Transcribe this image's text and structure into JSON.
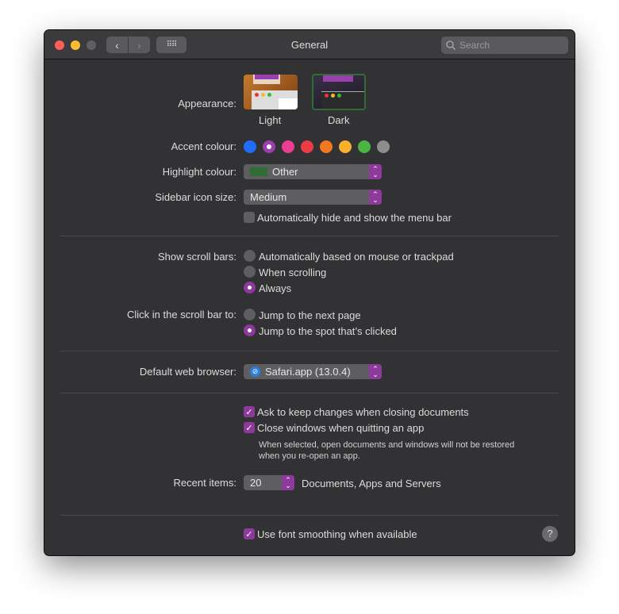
{
  "window": {
    "title": "General",
    "search_placeholder": "Search"
  },
  "appearance": {
    "label": "Appearance:",
    "options": [
      "Light",
      "Dark"
    ],
    "selected": "Dark"
  },
  "accent": {
    "label": "Accent colour:",
    "colors": [
      "#1f6dfb",
      "#9a3fad",
      "#ea3d93",
      "#ee3c44",
      "#f4781f",
      "#f7b02b",
      "#4bb542",
      "#8d8d8d"
    ],
    "selected": 1
  },
  "highlight": {
    "label": "Highlight colour:",
    "value": "Other",
    "swatch": "#2f6d35"
  },
  "sidebar_icon": {
    "label": "Sidebar icon size:",
    "value": "Medium"
  },
  "menubar": {
    "label": "Automatically hide and show the menu bar",
    "checked": false
  },
  "scroll_bars": {
    "label": "Show scroll bars:",
    "options": [
      "Automatically based on mouse or trackpad",
      "When scrolling",
      "Always"
    ],
    "selected": 2
  },
  "click_scroll": {
    "label": "Click in the scroll bar to:",
    "options": [
      "Jump to the next page",
      "Jump to the spot that’s clicked"
    ],
    "selected": 1
  },
  "browser": {
    "label": "Default web browser:",
    "value": "Safari.app (13.0.4)"
  },
  "docs": {
    "ask_keep": "Ask to keep changes when closing documents",
    "close_windows": "Close windows when quitting an app",
    "note1": "When selected, open documents and windows will not be restored",
    "note2": "when you re-open an app."
  },
  "recent": {
    "label": "Recent items:",
    "value": "20",
    "suffix": "Documents, Apps and Servers"
  },
  "font_smoothing": {
    "label": "Use font smoothing when available",
    "checked": true
  },
  "help": "?",
  "accent_color": "#8e3a9c"
}
